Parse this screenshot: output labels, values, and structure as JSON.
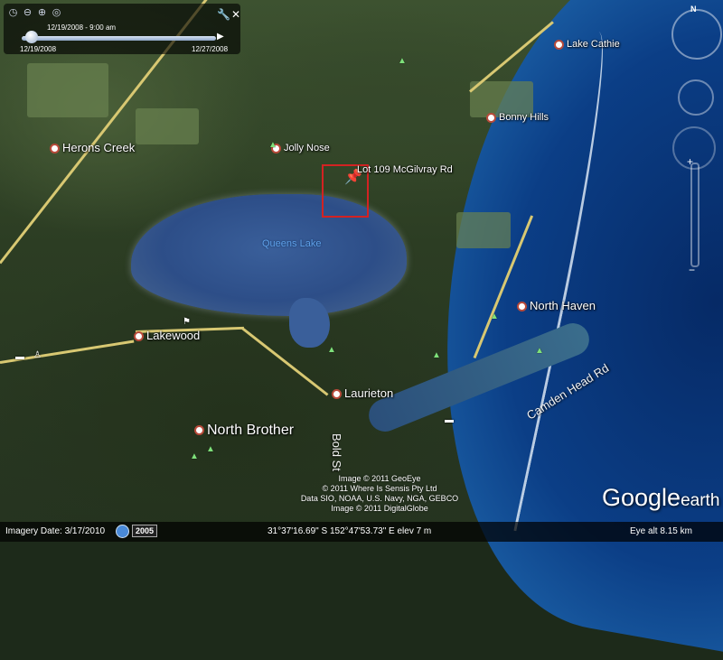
{
  "time_slider": {
    "current_date": "12/19/2008 - 9:00 am",
    "start_date": "12/19/2008",
    "end_date": "12/27/2008"
  },
  "places": {
    "lake_cathie": "Lake Cathie",
    "bonny_hills": "Bonny Hills",
    "herons_creek": "Herons Creek",
    "jolly_nose": "Jolly Nose",
    "lot_109": "Lot 109 McGilvray Rd",
    "queens_lake": "Queens Lake",
    "north_haven": "North Haven",
    "lakewood": "Lakewood",
    "laurieton": "Laurieton",
    "north_brother": "North Brother",
    "camden_head_rd": "Camden Head Rd",
    "bold_st": "Bold St"
  },
  "nav": {
    "north_label": "N"
  },
  "attribution": {
    "line1": "Image © 2011 GeoEye",
    "line2": "© 2011 Where Is Sensis Pty Ltd",
    "line3": "Data SIO, NOAA, U.S. Navy, NGA, GEBCO",
    "line4": "Image © 2011 DigitalGlobe"
  },
  "logo": {
    "google": "Google",
    "earth": "earth"
  },
  "status_bar": {
    "imagery_date": "Imagery Date: 3/17/2010",
    "history_year": "2005",
    "coordinates": "31°37'16.69\" S  152°47'53.73\" E  elev    7 m",
    "eye_alt": "Eye alt    8.15 km"
  },
  "colors": {
    "ocean": "#0b3e86",
    "lake": "#3a5f9a",
    "road": "#d8c872",
    "lot_boundary": "#d32222",
    "pin": "#f3e34a"
  }
}
